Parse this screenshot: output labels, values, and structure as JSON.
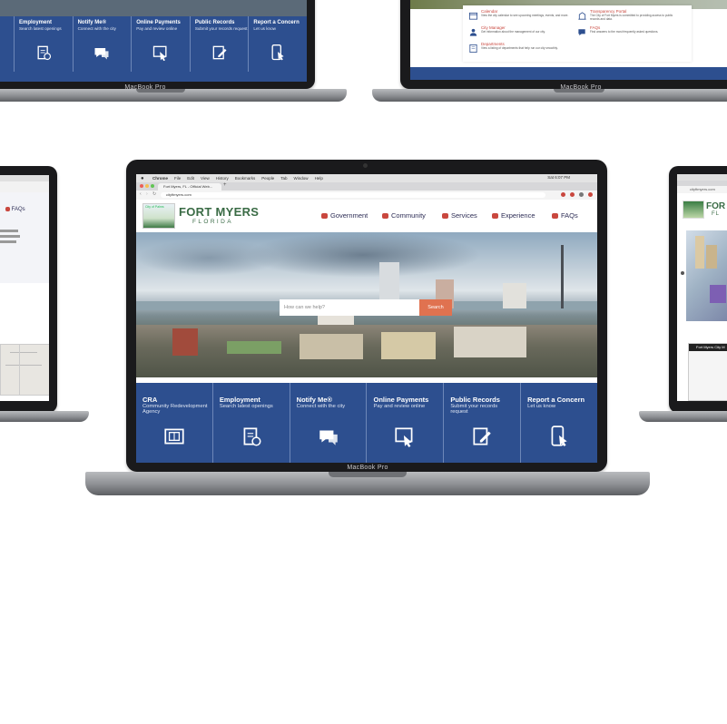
{
  "laptop_brand": "MacBook Pro",
  "colors": {
    "tile_blue": "#2d4f8f",
    "accent_red": "#c9473e",
    "navy_text": "#2d2d55"
  },
  "main": {
    "browser": {
      "menu": [
        "Chrome",
        "File",
        "Edit",
        "View",
        "History",
        "Bookmarks",
        "People",
        "Tab",
        "Window",
        "Help"
      ],
      "clock": "Sat 6:07 PM",
      "tab_title": "Fort Myers, FL - Official Web...",
      "url": "cityftmyers.com"
    },
    "site": {
      "logo_top": "City of Palms",
      "logo_name": "FORT MYERS",
      "logo_state": "FLORIDA",
      "nav": [
        {
          "label": "Government",
          "icon": "gavel-icon"
        },
        {
          "label": "Community",
          "icon": "home-icon"
        },
        {
          "label": "Services",
          "icon": "briefcase-icon"
        },
        {
          "label": "Experience",
          "icon": "camera-icon"
        },
        {
          "label": "FAQs",
          "icon": "chat-icon"
        }
      ],
      "search": {
        "placeholder": "How can we help?",
        "button": "Search"
      },
      "tiles": [
        {
          "title": "CRA",
          "subtitle": "Community Redevelopment Agency",
          "icon": "blueprint-icon"
        },
        {
          "title": "Employment",
          "subtitle": "Search latest openings",
          "icon": "clipboard-clock-icon"
        },
        {
          "title": "Notify Me®",
          "subtitle": "Connect with the city",
          "icon": "speech-bubble-icon"
        },
        {
          "title": "Online Payments",
          "subtitle": "Pay and review online",
          "icon": "payment-tap-icon"
        },
        {
          "title": "Public Records",
          "subtitle": "Submit your records request",
          "icon": "records-edit-icon"
        },
        {
          "title": "Report a Concern",
          "subtitle": "Let us know",
          "icon": "phone-tap-icon"
        }
      ]
    }
  },
  "top_left": {
    "tiles": [
      {
        "title": "Employment",
        "subtitle": "Search latest openings",
        "icon": "clipboard-clock-icon"
      },
      {
        "title": "Notify Me®",
        "subtitle": "Connect with the city",
        "icon": "speech-bubble-icon"
      },
      {
        "title": "Online Payments",
        "subtitle": "Pay and review online",
        "icon": "payment-tap-icon"
      },
      {
        "title": "Public Records",
        "subtitle": "Submit your records request",
        "icon": "records-edit-icon"
      },
      {
        "title": "Report a Concern",
        "subtitle": "Let us know",
        "icon": "phone-tap-icon"
      }
    ]
  },
  "top_right": {
    "links": [
      {
        "title": "Calendar",
        "desc": "View the city calendar to see upcoming meetings, events, and more.",
        "icon": "calendar-icon"
      },
      {
        "title": "Transparency Portal",
        "desc": "The City of Fort Myers is committed to providing access to public records and data.",
        "icon": "building-icon"
      },
      {
        "title": "City Manager",
        "desc": "Get information about the management of our city.",
        "icon": "person-icon"
      },
      {
        "title": "FAQs",
        "desc": "Find answers to the most frequently asked questions.",
        "icon": "faq-icon"
      },
      {
        "title": "Departments",
        "desc": "View a listing of departments that help run our city smoothly.",
        "icon": "departments-icon"
      }
    ]
  },
  "left": {
    "faq_label": "FAQs"
  },
  "right": {
    "logo_partial": "FOR",
    "logo_state_partial": "FL",
    "url_partial": "cityftmyers.com",
    "map_label": "Fort Myers City M"
  }
}
